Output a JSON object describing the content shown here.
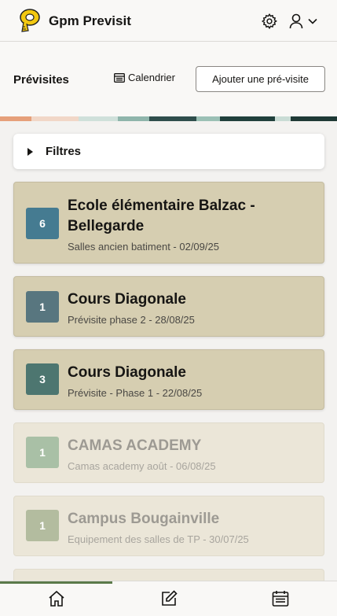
{
  "header": {
    "app_title": "Gpm Previsit"
  },
  "toolbar": {
    "page_title": "Prévisites",
    "calendar_label": "Calendrier",
    "add_label": "Ajouter une pré-visite"
  },
  "filters": {
    "label": "Filtres"
  },
  "cards": [
    {
      "count": "6",
      "title": "Ecole élémentaire Balzac - Bellegarde",
      "subtitle": "Salles ancien batiment - 02/09/25",
      "badge_color": "#457b91",
      "faded": false
    },
    {
      "count": "1",
      "title": "Cours Diagonale",
      "subtitle": "Prévisite phase 2 - 28/08/25",
      "badge_color": "#58767f",
      "faded": false
    },
    {
      "count": "3",
      "title": "Cours Diagonale",
      "subtitle": "Prévisite - Phase 1 - 22/08/25",
      "badge_color": "#4d7670",
      "faded": false
    },
    {
      "count": "1",
      "title": "CAMAS ACADEMY",
      "subtitle": "Camas academy août - 06/08/25",
      "badge_color": "#a9c0a6",
      "faded": true
    },
    {
      "count": "1",
      "title": "Campus Bougainville",
      "subtitle": "Equipement des salles de TP - 30/07/25",
      "badge_color": "#b3bc9f",
      "faded": true
    }
  ],
  "colors": {
    "accent": "#5b7a4a",
    "card_bg": "#d6ceb1"
  },
  "icons": {
    "logo": "measuring-tape-logo-icon",
    "settings": "gear-icon",
    "user": "user-icon",
    "nav": [
      "home-icon",
      "edit-icon",
      "calendar-icon"
    ]
  }
}
